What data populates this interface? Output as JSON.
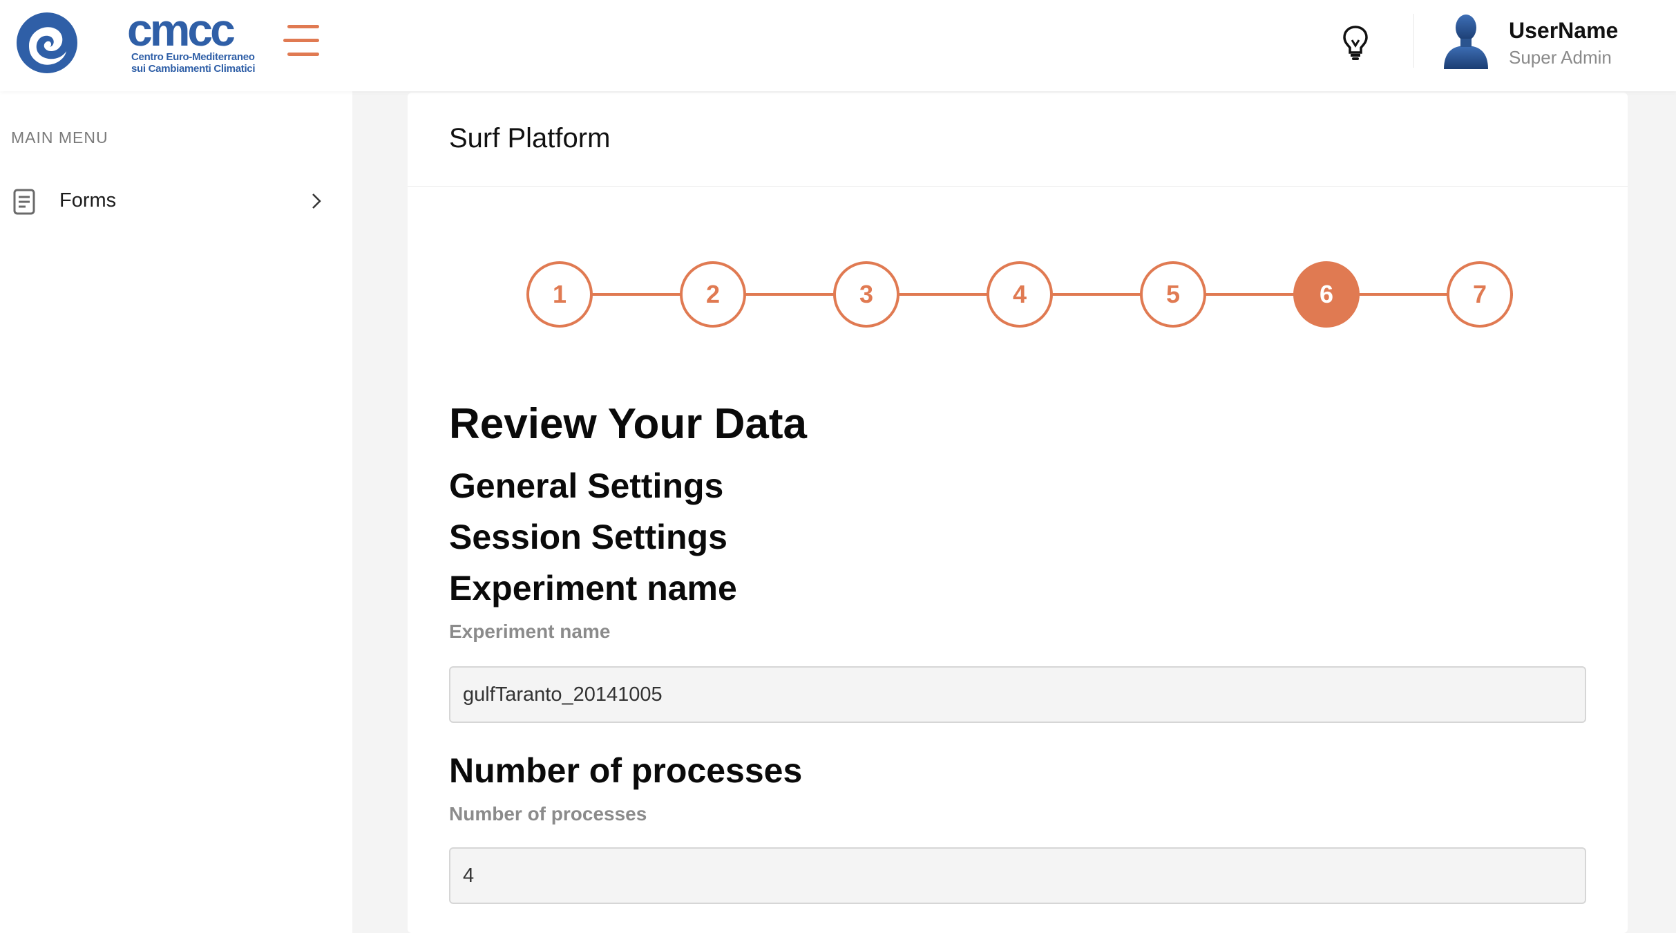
{
  "header": {
    "logo": {
      "word": "cmcc",
      "line1": "Centro Euro-Mediterraneo",
      "line2": "sui Cambiamenti Climatici"
    },
    "user": {
      "name": "UserName",
      "role": "Super Admin"
    },
    "icons": [
      "wave-logo-icon",
      "hamburger-icon",
      "lightbulb-icon",
      "user-avatar-icon"
    ]
  },
  "sidebar": {
    "title": "MAIN MENU",
    "items": [
      {
        "label": "Forms",
        "icon": "form-document-icon"
      }
    ]
  },
  "card": {
    "title": "Surf Platform"
  },
  "stepper": {
    "steps": [
      "1",
      "2",
      "3",
      "4",
      "5",
      "6",
      "7"
    ],
    "active_step": "6"
  },
  "review": {
    "heading": "Review Your Data",
    "general_settings": "General Settings",
    "session_settings": "Session Settings",
    "experiment_name_heading": "Experiment name",
    "experiment_name_label": "Experiment name",
    "experiment_name_value": "gulfTaranto_20141005",
    "processes_heading": "Number of processes",
    "processes_label": "Number of processes",
    "processes_value": "4"
  },
  "colors": {
    "accent": "#e07a52",
    "brand": "#2f5fa7",
    "background": "#f4f4f4"
  }
}
